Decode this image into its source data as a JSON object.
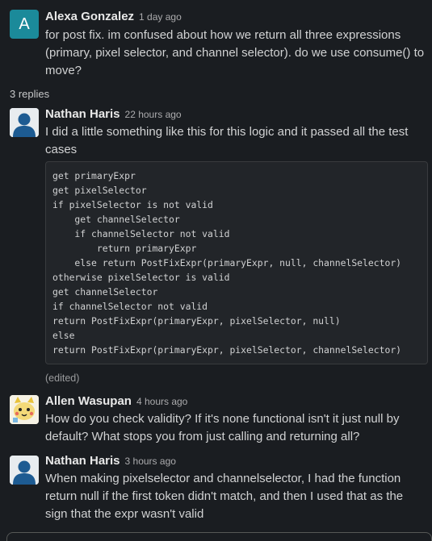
{
  "thread": {
    "parent": {
      "avatar_letter": "A",
      "author": "Alexa Gonzalez",
      "time": "1 day ago",
      "text": "for post fix. im confused about how we return all three expressions (primary, pixel selector, and channel selector). do we use consume() to move?"
    },
    "replies_label": "3 replies",
    "replies": [
      {
        "author": "Nathan Haris",
        "time": "22 hours ago",
        "text": "I did a little something like this for this logic and it passed all the test cases",
        "code": "get primaryExpr\nget pixelSelector\nif pixelSelector is not valid\n    get channelSelector\n    if channelSelector not valid\n        return primaryExpr\n    else return PostFixExpr(primaryExpr, null, channelSelector)\notherwise pixelSelector is valid\nget channelSelector\nif channelSelector not valid\nreturn PostFixExpr(primaryExpr, pixelSelector, null)\nelse\nreturn PostFixExpr(primaryExpr, pixelSelector, channelSelector)",
        "edited": "(edited)"
      },
      {
        "author": "Allen Wasupan",
        "time": "4 hours ago",
        "text": "How do you check validity? If it's none functional isn't it just null by default? What stops you from just calling and returning all?"
      },
      {
        "author": "Nathan Haris",
        "time": "3 hours ago",
        "text": "When making pixelselector and channelselector, I had the function return null if the first token didn't match, and then I used that as the sign that the expr wasn't valid"
      }
    ]
  },
  "colors": {
    "background": "#1a1d21",
    "code_background": "#222529",
    "avatar_teal": "#1b8a9a"
  }
}
